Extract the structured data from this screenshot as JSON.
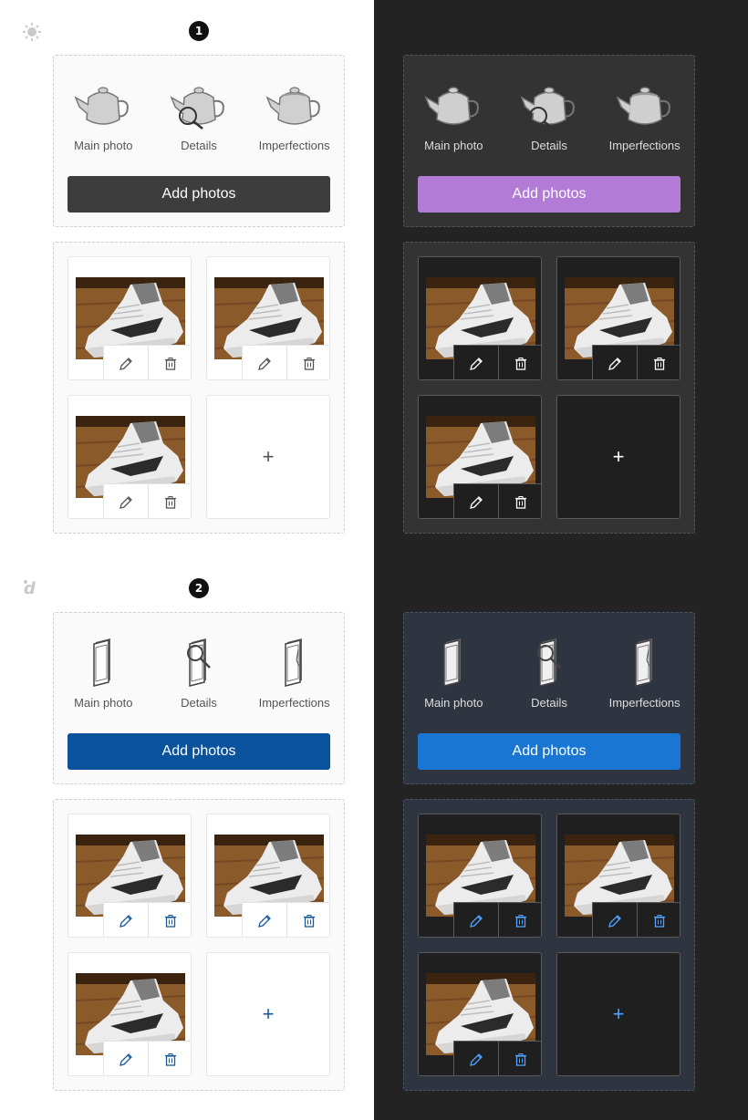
{
  "panels": [
    {
      "id": "variant-1-light",
      "step": "1",
      "brand_icon": "sun-icon",
      "icon_style": "teapot",
      "categories": [
        "Main photo",
        "Details",
        "Imperfections"
      ],
      "add_label": "Add photos",
      "button_color": "#3d3d3d",
      "icon_color": "#555555",
      "plus": "+"
    },
    {
      "id": "variant-1-dark",
      "icon_style": "teapot",
      "categories": [
        "Main photo",
        "Details",
        "Imperfections"
      ],
      "add_label": "Add photos",
      "button_color": "#b27bd6",
      "icon_color": "#ffffff",
      "plus": "+"
    },
    {
      "id": "variant-2-light",
      "step": "2",
      "brand_icon": "brand-d-logo-icon",
      "icon_style": "phone",
      "categories": [
        "Main photo",
        "Details",
        "Imperfections"
      ],
      "add_label": "Add photos",
      "button_color": "#0b529c",
      "icon_color": "#1a5a9a",
      "plus": "+"
    },
    {
      "id": "variant-2-dark",
      "icon_style": "phone",
      "categories": [
        "Main photo",
        "Details",
        "Imperfections"
      ],
      "add_label": "Add photos",
      "button_color": "#1976d2",
      "icon_color": "#4da3ff",
      "plus": "+"
    }
  ]
}
